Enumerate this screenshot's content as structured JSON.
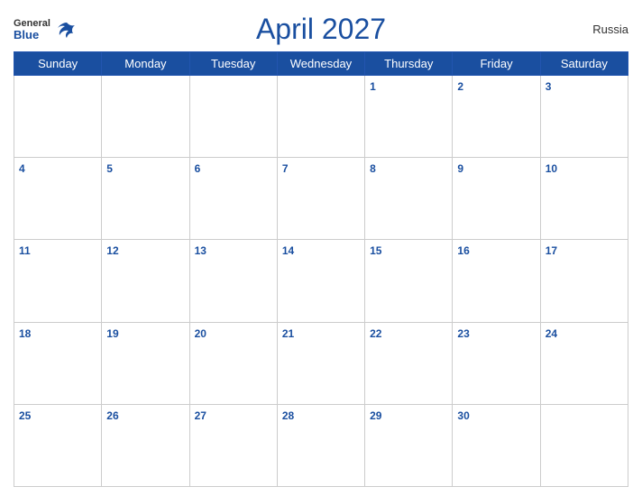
{
  "header": {
    "title": "April 2027",
    "country": "Russia",
    "logo": {
      "general": "General",
      "blue": "Blue"
    }
  },
  "calendar": {
    "days_of_week": [
      "Sunday",
      "Monday",
      "Tuesday",
      "Wednesday",
      "Thursday",
      "Friday",
      "Saturday"
    ],
    "weeks": [
      [
        null,
        null,
        null,
        null,
        1,
        2,
        3
      ],
      [
        4,
        5,
        6,
        7,
        8,
        9,
        10
      ],
      [
        11,
        12,
        13,
        14,
        15,
        16,
        17
      ],
      [
        18,
        19,
        20,
        21,
        22,
        23,
        24
      ],
      [
        25,
        26,
        27,
        28,
        29,
        30,
        null
      ]
    ]
  }
}
